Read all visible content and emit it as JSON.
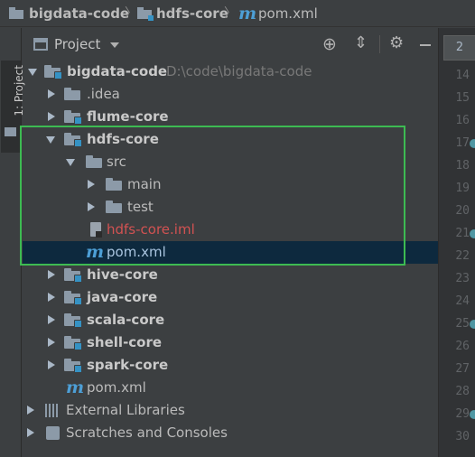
{
  "breadcrumb": {
    "project": "bigdata-code",
    "module": "hdfs-core",
    "file": "pom.xml"
  },
  "tool_window": {
    "stripe_label": "1: Project",
    "title": "Project"
  },
  "tree": {
    "root": {
      "name": "bigdata-code",
      "path": "D:\\code\\bigdata-code"
    },
    "idea": ".idea",
    "flume": "flume-core",
    "hdfs": "hdfs-core",
    "src": "src",
    "main": "main",
    "test": "test",
    "iml": "hdfs-core.iml",
    "hdfs_pom": "pom.xml",
    "hive": "hive-core",
    "java": "java-core",
    "scala": "scala-core",
    "shell": "shell-core",
    "spark": "spark-core",
    "root_pom": "pom.xml",
    "external": "External Libraries",
    "scratches": "Scratches and Consoles"
  },
  "editor": {
    "tab_label": "2",
    "line_numbers": [
      "14",
      "15",
      "16",
      "17",
      "18",
      "19",
      "20",
      "21",
      "22",
      "23",
      "24",
      "25",
      "26",
      "27",
      "28",
      "29",
      "30"
    ]
  },
  "colors": {
    "selection": "#0d293e",
    "highlight_box": "#3dbb52",
    "iml_text": "#d25252",
    "maven_icon": "#4d9fd6"
  }
}
